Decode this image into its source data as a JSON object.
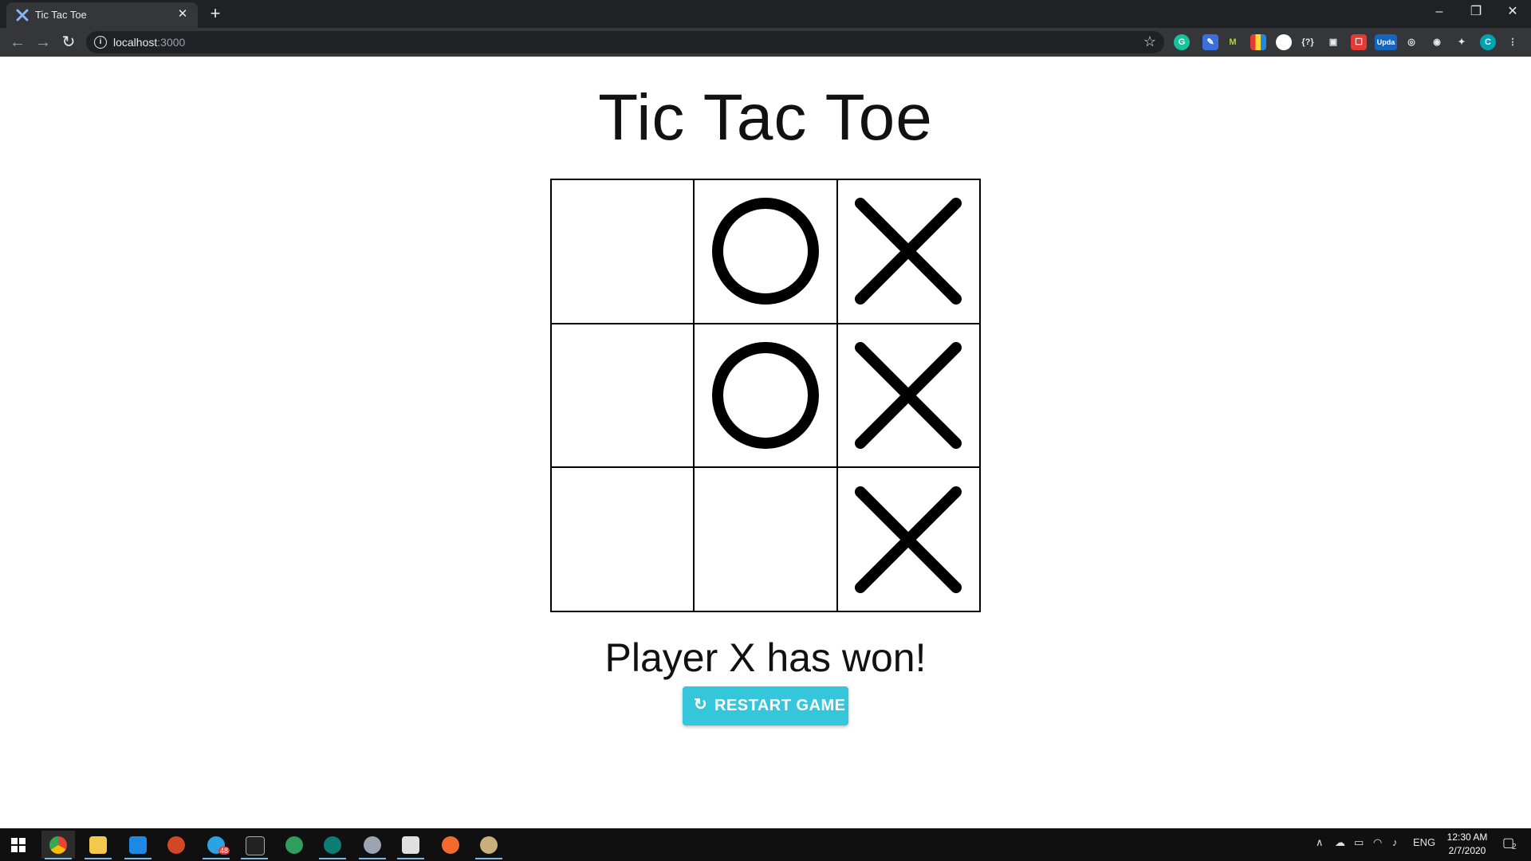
{
  "browser": {
    "tab_title": "Tic Tac Toe",
    "url_host": "localhost",
    "url_port": ":3000",
    "new_tab_symbol": "+",
    "close_symbol": "✕"
  },
  "page": {
    "title": "Tic Tac Toe",
    "board": [
      [
        "",
        "O",
        "X"
      ],
      [
        "",
        "O",
        "X"
      ],
      [
        "",
        "",
        "X"
      ]
    ],
    "status": "Player X has won!",
    "restart_label": "RESTART GAME",
    "accent_color": "#35c6dc"
  },
  "taskbar": {
    "language": "ENG",
    "time": "12:30 AM",
    "date": "2/7/2020",
    "notification_count": "2",
    "telegram_badge": "48",
    "extension_label": "Upda"
  }
}
